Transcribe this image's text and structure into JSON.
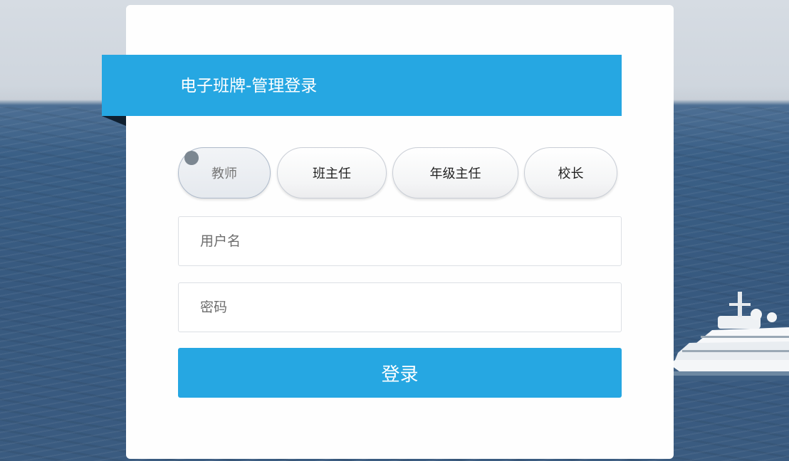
{
  "header": {
    "title": "电子班牌-管理登录"
  },
  "roles": [
    {
      "label": "教师",
      "selected": true
    },
    {
      "label": "班主任",
      "selected": false
    },
    {
      "label": "年级主任",
      "selected": false
    },
    {
      "label": "校长",
      "selected": false
    }
  ],
  "form": {
    "username_placeholder": "用户名",
    "username_value": "",
    "password_placeholder": "密码",
    "password_value": "",
    "login_label": "登录"
  },
  "colors": {
    "accent": "#26a7e2",
    "card": "#fefefe"
  }
}
